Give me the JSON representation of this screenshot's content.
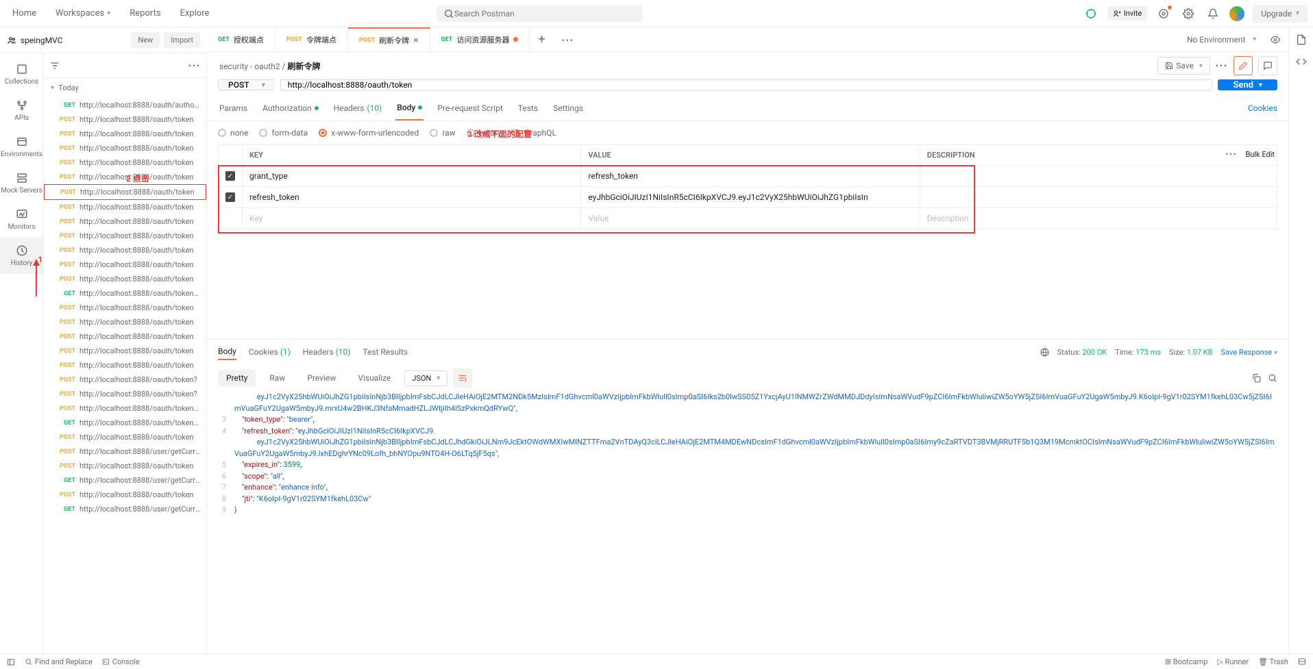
{
  "topbar": {
    "home": "Home",
    "workspaces": "Workspaces",
    "reports": "Reports",
    "explore": "Explore",
    "search_placeholder": "Search Postman",
    "invite": "Invite",
    "upgrade": "Upgrade"
  },
  "workspace": {
    "name": "speingMVC",
    "new_btn": "New",
    "import_btn": "Import"
  },
  "rail": {
    "collections": "Collections",
    "apis": "APIs",
    "environments": "Environments",
    "mockservers": "Mock Servers",
    "monitors": "Monitors",
    "history": "History"
  },
  "history": {
    "group": "Today",
    "annotation1": "1",
    "annotation2": "2 点击",
    "items": [
      {
        "m": "GET",
        "u": "http://localhost:8888/oauth/authoriz"
      },
      {
        "m": "POST",
        "u": "http://localhost:8888/oauth/token"
      },
      {
        "m": "POST",
        "u": "http://localhost:8888/oauth/token"
      },
      {
        "m": "POST",
        "u": "http://localhost:8888/oauth/token"
      },
      {
        "m": "POST",
        "u": "http://localhost:8888/oauth/token"
      },
      {
        "m": "POST",
        "u": "http://localhost:8888/oauth/token"
      },
      {
        "m": "POST",
        "u": "http://localhost:8888/oauth/token",
        "selected": true
      },
      {
        "m": "POST",
        "u": "http://localhost:8888/oauth/token"
      },
      {
        "m": "POST",
        "u": "http://localhost:8888/oauth/token"
      },
      {
        "m": "POST",
        "u": "http://localhost:8888/oauth/token"
      },
      {
        "m": "POST",
        "u": "http://localhost:8888/oauth/token"
      },
      {
        "m": "POST",
        "u": "http://localhost:8888/oauth/token"
      },
      {
        "m": "POST",
        "u": "http://localhost:8888/oauth/token"
      },
      {
        "m": "GET",
        "u": "http://localhost:8888/oauth/token?g"
      },
      {
        "m": "POST",
        "u": "http://localhost:8888/oauth/token"
      },
      {
        "m": "POST",
        "u": "http://localhost:8888/oauth/token"
      },
      {
        "m": "POST",
        "u": "http://localhost:8888/oauth/token"
      },
      {
        "m": "POST",
        "u": "http://localhost:8888/oauth/token"
      },
      {
        "m": "POST",
        "u": "http://localhost:8888/oauth/token"
      },
      {
        "m": "POST",
        "u": "http://localhost:8888/oauth/token?"
      },
      {
        "m": "POST",
        "u": "http://localhost:8888/oauth/token?"
      },
      {
        "m": "POST",
        "u": "http://localhost:8888/oauth/token?g"
      },
      {
        "m": "GET",
        "u": "http://localhost:8888/oauth/token?g"
      },
      {
        "m": "POST",
        "u": "http://localhost:8888/oauth/token"
      },
      {
        "m": "POST",
        "u": "http://localhost:8888/user/getCurren"
      },
      {
        "m": "POST",
        "u": "http://localhost:8888/oauth/token"
      },
      {
        "m": "GET",
        "u": "http://localhost:8888/user/getCurren"
      },
      {
        "m": "POST",
        "u": "http://localhost:8888/oauth/token"
      },
      {
        "m": "GET",
        "u": "http://localhost:8888/user/getCurren"
      }
    ]
  },
  "tabs": [
    {
      "method": "GET",
      "mcolor": "get",
      "label": "授权端点"
    },
    {
      "method": "POST",
      "mcolor": "post",
      "label": "令牌端点"
    },
    {
      "method": "POST",
      "mcolor": "post",
      "label": "刷新令牌",
      "active": true,
      "closable": true
    },
    {
      "method": "GET",
      "mcolor": "get",
      "label": "访问资源服务器",
      "dirty": true
    }
  ],
  "env": {
    "none": "No Environment"
  },
  "breadcrumb": {
    "parent": "security - oauth2",
    "current": "刷新令牌"
  },
  "savebtn": "Save",
  "request": {
    "method": "POST",
    "url": "http://localhost:8888/oauth/token",
    "send": "Send"
  },
  "subtabs": {
    "params": "Params",
    "auth": "Authorization",
    "headers": "Headers",
    "headers_count": "(10)",
    "body": "Body",
    "prerequest": "Pre-request Script",
    "tests": "Tests",
    "settings": "Settings",
    "cookies": "Cookies"
  },
  "bodytypes": {
    "none": "none",
    "formdata": "form-data",
    "xwww": "x-www-form-urlencoded",
    "raw": "raw",
    "binary": "binary",
    "graphql": "GraphQL"
  },
  "kv": {
    "annotation3": "3 改成下面的配置",
    "th_key": "KEY",
    "th_value": "VALUE",
    "th_desc": "DESCRIPTION",
    "bulk": "Bulk Edit",
    "ph_key": "Key",
    "ph_value": "Value",
    "ph_desc": "Description",
    "rows": [
      {
        "k": "grant_type",
        "v": "refresh_token"
      },
      {
        "k": "refresh_token",
        "v": "eyJhbGciOiJIUzI1NiIsInR5cCI6IkpXVCJ9.eyJ1c2VyX25hbWUiOiJhZG1pbiIsIn"
      }
    ]
  },
  "response": {
    "tabs": {
      "body": "Body",
      "cookies": "Cookies",
      "cookies_count": "(1)",
      "headers": "Headers",
      "headers_count": "(10)",
      "tests": "Test Results"
    },
    "status_label": "Status:",
    "status": "200 OK",
    "time_label": "Time:",
    "time": "173 ms",
    "size_label": "Size:",
    "size": "1.07 KB",
    "save": "Save Response",
    "views": {
      "pretty": "Pretty",
      "raw": "Raw",
      "preview": "Preview",
      "visualize": "Visualize",
      "json": "JSON"
    },
    "lines": [
      {
        "n": "",
        "indent": 3,
        "raw": "eyJ1c2VyX25hbWUiOiJhZG1pbiIsInNjb3BlIjpbImFsbCJdLCJleHAiOjE2MTM2NDk5MzIsImF1dGhvcml0aWVzIjpbImFkbWluIl0sImp0aSI6Iks2b0lwSS05Z1YxcjAyU1lNMWZrZWdMMDJDdyIsImNsaWVudF9pZCI6ImFkbWluIiwiZW5oYW5jZSI6ImVuaGFuY2UgaW5mbyJ9.K6oIpI-9gV1r02SYM1fkehL03Cw5jZSI6ImVuaGFuY2UgaW5mbyJ9.mrxU4w2BHKJ3NfaMmadHZLJWtjiIh4iSzPxkmQdRYwQ\","
      },
      {
        "n": "3",
        "indent": 1,
        "key": "token_type",
        "val": "\"bearer\"",
        "comma": true
      },
      {
        "n": "4",
        "indent": 1,
        "key": "refresh_token",
        "val": "\"eyJhbGciOiJIUzI1NiIsInR5cCI6IkpXVCJ9.",
        "cont": "eyJ1c2VyX25hbWUiOiJhZG1pbiIsInNjb3BlIjpbImFsbCJdLCJhdGkiOiJLNm9JcEktOWdWMXIwMlNZTTFma2VnTDAyQ3ciLCJleHAiOjE2MTM4MDEwNDcsImF1dGhvcml0aWVzIjpbImFkbWluIl0sImp0aSI6Imy9cZaRTVDT3BVMjRRUTF5b1Q3M19McmktOCIsImNsaWVudF9pZCI6ImFkbWluIiwiZW5oYW5jZSI6ImVuaGFuY2UgaW5mbyJ9.IxhEDghrYNc09Lofh_bhNYOpu9NTO4H-O6LTq5jF5qs\","
      },
      {
        "n": "5",
        "indent": 1,
        "key": "expires_in",
        "num": "3599",
        "comma": true
      },
      {
        "n": "6",
        "indent": 1,
        "key": "scope",
        "val": "\"all\"",
        "comma": true
      },
      {
        "n": "7",
        "indent": 1,
        "key": "enhance",
        "val": "\"enhance info\"",
        "comma": true
      },
      {
        "n": "8",
        "indent": 1,
        "key": "jti",
        "val": "\"K6oIpI-9gV1r02SYM1fkehL03Cw\""
      },
      {
        "n": "9",
        "indent": 0,
        "raw": "}"
      }
    ]
  },
  "footer": {
    "find": "Find and Replace",
    "console": "Console",
    "bootcamp": "Bootcamp",
    "runner": "Runner",
    "trash": "Trash"
  }
}
